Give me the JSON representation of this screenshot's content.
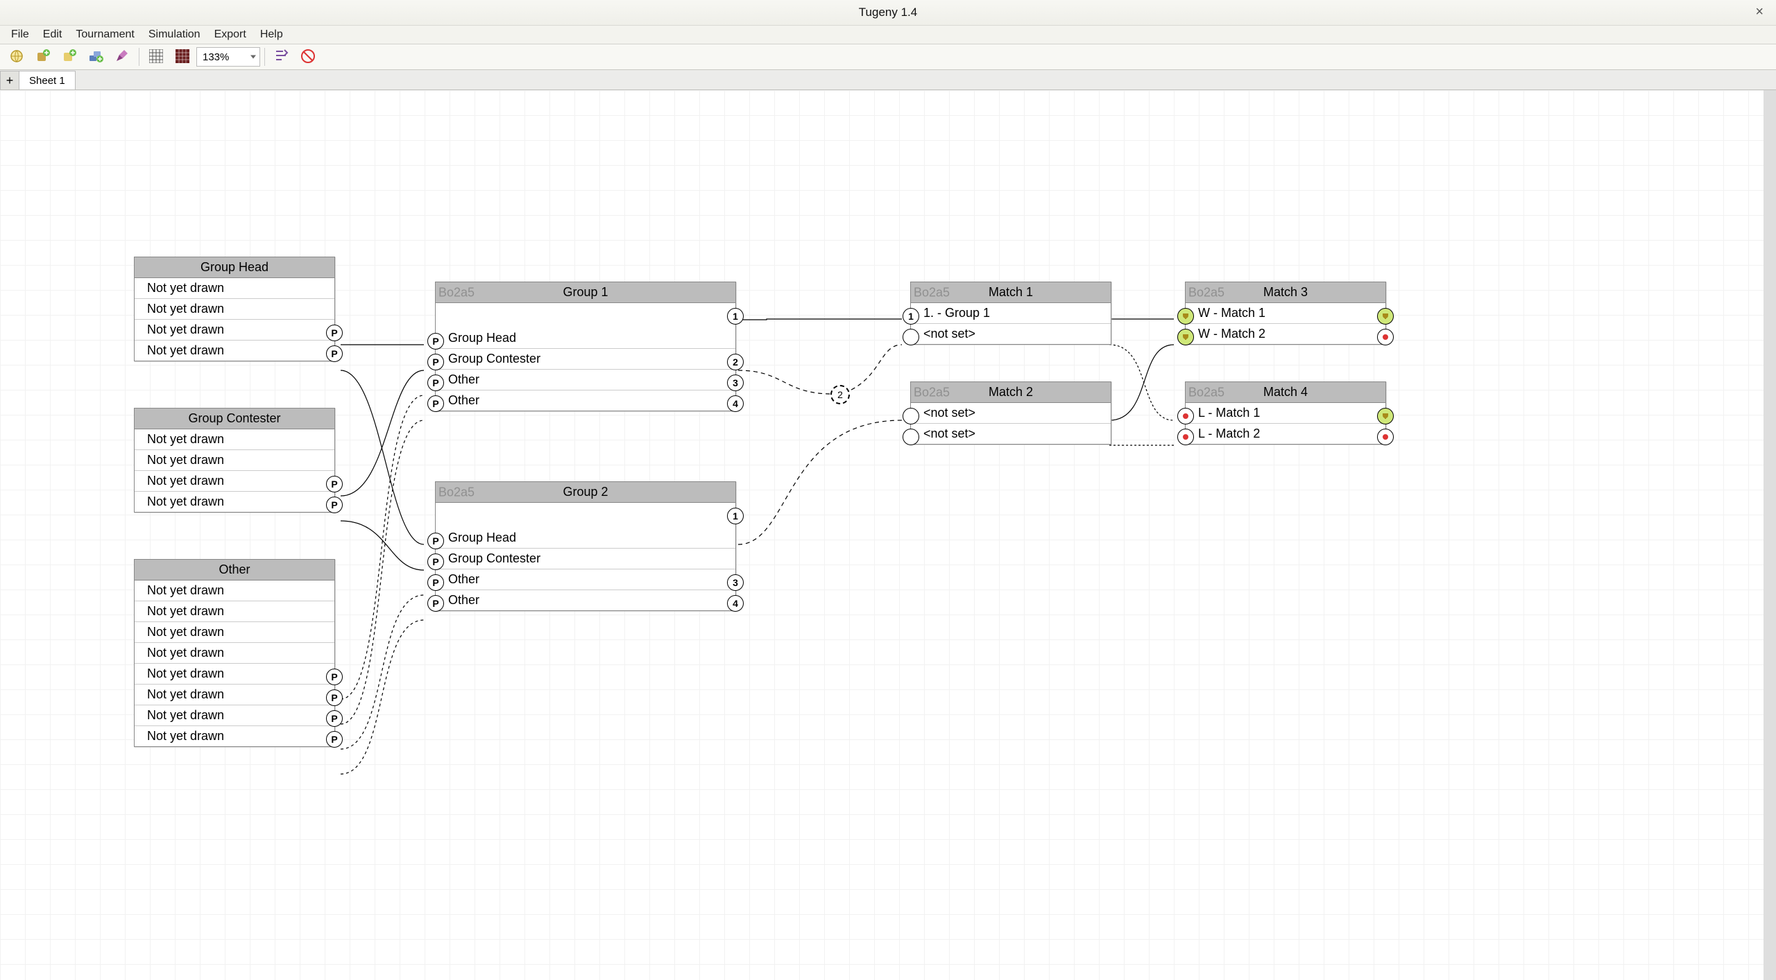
{
  "window": {
    "title": "Tugeny 1.4",
    "close": "×"
  },
  "menu": {
    "file": "File",
    "edit": "Edit",
    "tournament": "Tournament",
    "simulation": "Simulation",
    "export": "Export",
    "help": "Help"
  },
  "toolbar": {
    "zoom": "133%"
  },
  "tabs": {
    "add": "+",
    "sheet1": "Sheet 1"
  },
  "pools": {
    "group_head": {
      "title": "Group Head",
      "rows": [
        "Not yet drawn",
        "Not yet drawn",
        "Not yet drawn",
        "Not yet drawn"
      ]
    },
    "group_contester": {
      "title": "Group Contester",
      "rows": [
        "Not yet drawn",
        "Not yet drawn",
        "Not yet drawn",
        "Not yet drawn"
      ]
    },
    "other": {
      "title": "Other",
      "rows": [
        "Not yet drawn",
        "Not yet drawn",
        "Not yet drawn",
        "Not yet drawn",
        "Not yet drawn",
        "Not yet drawn",
        "Not yet drawn",
        "Not yet drawn"
      ]
    }
  },
  "groups": {
    "g1": {
      "tag": "Bo2a5",
      "title": "Group 1",
      "rows": [
        "Group Head",
        "Group Contester",
        "Other",
        "Other"
      ]
    },
    "g2": {
      "tag": "Bo2a5",
      "title": "Group 2",
      "rows": [
        "Group Head",
        "Group Contester",
        "Other",
        "Other"
      ]
    }
  },
  "matches": {
    "m1": {
      "tag": "Bo2a5",
      "title": "Match 1",
      "rows": [
        "1. - Group 1",
        "<not set>"
      ]
    },
    "m2": {
      "tag": "Bo2a5",
      "title": "Match 2",
      "rows": [
        "<not set>",
        "<not set>"
      ]
    },
    "m3": {
      "tag": "Bo2a5",
      "title": "Match 3",
      "rows": [
        "W - Match 1",
        "W - Match 2"
      ]
    },
    "m4": {
      "tag": "Bo2a5",
      "title": "Match 4",
      "rows": [
        "L - Match 1",
        "L - Match 2"
      ]
    }
  },
  "port_label": {
    "p": "P",
    "one": "1",
    "two": "2",
    "three": "3",
    "four": "4"
  },
  "float_port": "2"
}
